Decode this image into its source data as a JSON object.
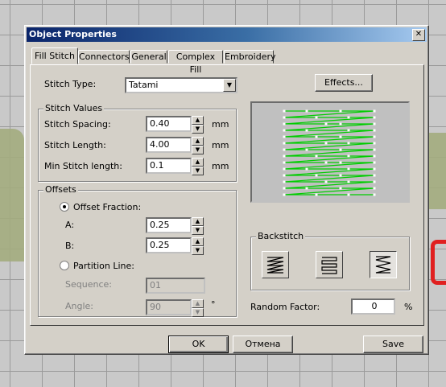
{
  "dialog": {
    "title": "Object Properties",
    "close_symbol": "✕"
  },
  "tabs": [
    {
      "label": "Fill Stitch",
      "active": true
    },
    {
      "label": "Connectors"
    },
    {
      "label": "General"
    },
    {
      "label": "Complex Fill"
    },
    {
      "label": "Embroidery"
    }
  ],
  "stitch_type": {
    "label": "Stitch Type:",
    "value": "Tatami"
  },
  "effects_button": "Effects...",
  "stitch_values": {
    "title": "Stitch Values",
    "rows": [
      {
        "label": "Stitch Spacing:",
        "value": "0.40",
        "unit": "mm"
      },
      {
        "label": "Stitch Length:",
        "value": "4.00",
        "unit": "mm"
      },
      {
        "label": "Min Stitch length:",
        "value": "0.1",
        "unit": "mm"
      }
    ]
  },
  "offsets": {
    "title": "Offsets",
    "offset_fraction_label": "Offset Fraction:",
    "a_label": "A:",
    "a_value": "0.25",
    "b_label": "B:",
    "b_value": "0.25",
    "partition_line_label": "Partition Line:",
    "sequence_label": "Sequence:",
    "sequence_value": "01",
    "angle_label": "Angle:",
    "angle_value": "90",
    "angle_unit": "°"
  },
  "backstitch": {
    "title": "Backstitch"
  },
  "random_factor": {
    "label": "Random Factor:",
    "value": "0",
    "unit": "%"
  },
  "buttons": {
    "ok": "OK",
    "cancel": "Отмена",
    "save": "Save"
  },
  "colors": {
    "stitch_green": "#00cc00",
    "title_blue": "#0a246a"
  }
}
